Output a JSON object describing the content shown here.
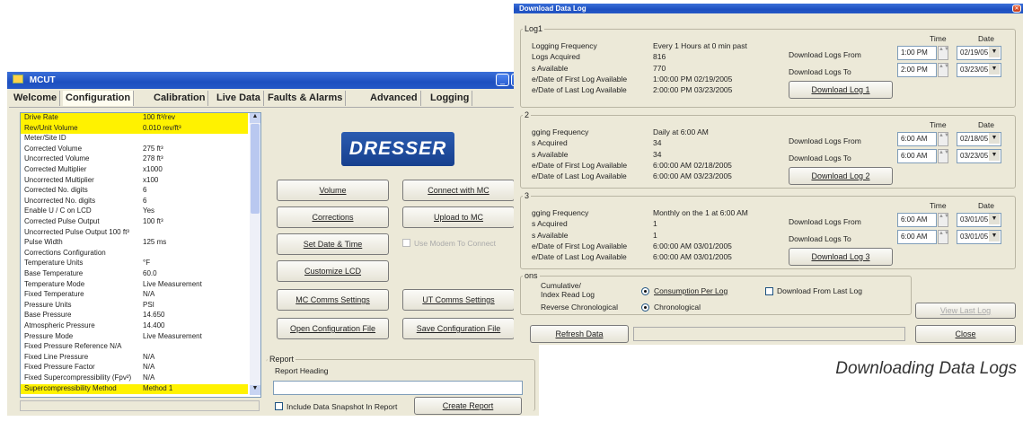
{
  "caption": "Downloading Data Logs",
  "mcut": {
    "title": "MCUT",
    "tabs": [
      "Welcome",
      "Configuration",
      "Calibration",
      "Live Data",
      "Faults & Alarms",
      "Advanced",
      "Logging"
    ],
    "list": [
      {
        "k": "Drive Rate",
        "v": "100 ft³/rev",
        "hl": true
      },
      {
        "k": "Rev/Unit Volume",
        "v": "0.010 rev/ft³",
        "hl": true
      },
      {
        "k": "Meter/Site ID",
        "v": ""
      },
      {
        "k": "Corrected Volume",
        "v": "275 ft³"
      },
      {
        "k": "Uncorrected Volume",
        "v": "278 ft³"
      },
      {
        "k": "Corrected Multiplier",
        "v": "x1000"
      },
      {
        "k": "Uncorrected Multiplier",
        "v": "x100"
      },
      {
        "k": "Corrected No. digits",
        "v": "6"
      },
      {
        "k": "Uncorrected No. digits",
        "v": "6"
      },
      {
        "k": "Enable U / C on LCD",
        "v": "Yes"
      },
      {
        "k": "Corrected Pulse Output",
        "v": "100 ft³"
      },
      {
        "k": "Uncorrected Pulse Output  100 ft³",
        "v": ""
      },
      {
        "k": "Pulse Width",
        "v": "125 ms"
      },
      {
        "k": "Corrections Configuration",
        "v": ""
      },
      {
        "k": "Temperature Units",
        "v": "°F"
      },
      {
        "k": "Base Temperature",
        "v": "60.0"
      },
      {
        "k": "Temperature Mode",
        "v": "Live Measurement"
      },
      {
        "k": "Fixed Temperature",
        "v": "N/A"
      },
      {
        "k": "Pressure Units",
        "v": "PSI"
      },
      {
        "k": "Base Pressure",
        "v": "14.650"
      },
      {
        "k": "Atmospheric Pressure",
        "v": "14.400"
      },
      {
        "k": "Pressure Mode",
        "v": "Live Measurement"
      },
      {
        "k": "Fixed Pressure Reference  N/A",
        "v": ""
      },
      {
        "k": "Fixed Line Pressure",
        "v": "N/A"
      },
      {
        "k": "Fixed Pressure Factor",
        "v": "N/A"
      },
      {
        "k": "Fixed Supercompressibility (Fpv²)",
        "v": "N/A"
      },
      {
        "k": "Supercompressibility Method",
        "v": "Method 1",
        "hl": true
      }
    ],
    "logo": "DRESSER",
    "buttons": {
      "volume": "Volume",
      "connect": "Connect with MC",
      "corrections": "Corrections",
      "upload": "Upload to MC",
      "setdate": "Set Date & Time",
      "modem": "Use Modem To Connect",
      "customize": "Customize LCD",
      "mccomms": "MC Comms Settings",
      "utcomms": "UT Comms Settings",
      "openconf": "Open Configuration File",
      "saveconf": "Save Configuration File"
    },
    "report": {
      "group": "Report",
      "heading": "Report Heading",
      "snapshot": "Include Data Snapshot In Report",
      "create": "Create Report"
    }
  },
  "ddl": {
    "title": "Download Data Log",
    "time_hdr": "Time",
    "date_hdr": "Date",
    "groups": [
      {
        "label": "Log1",
        "rows": [
          [
            "Logging Frequency",
            "Every 1 Hours at 0 min past"
          ],
          [
            "Logs Acquired",
            "816"
          ],
          [
            "s Available",
            "770"
          ],
          [
            "e/Date of First Log Available",
            "1:00:00 PM 02/19/2005"
          ],
          [
            "e/Date of Last Log Available",
            "2:00:00 PM 03/23/2005"
          ]
        ],
        "from_lbl": "Download Logs From",
        "to_lbl": "Download Logs To",
        "from_time": "1:00 PM",
        "from_date": "02/19/05",
        "to_time": "2:00 PM",
        "to_date": "03/23/05",
        "btn": "Download Log 1"
      },
      {
        "label": "2",
        "rows": [
          [
            "gging Frequency",
            "Daily at 6:00 AM"
          ],
          [
            "s Acquired",
            "34"
          ],
          [
            "s Available",
            "34"
          ],
          [
            "e/Date of First Log Available",
            "6:00:00 AM 02/18/2005"
          ],
          [
            "e/Date of Last Log Available",
            "6:00:00 AM 03/23/2005"
          ]
        ],
        "from_lbl": "Download Logs From",
        "to_lbl": "Download Logs To",
        "from_time": "6:00 AM",
        "from_date": "02/18/05",
        "to_time": "6:00 AM",
        "to_date": "03/23/05",
        "btn": "Download Log 2"
      },
      {
        "label": "3",
        "rows": [
          [
            "gging Frequency",
            "Monthly on the 1 at 6:00 AM"
          ],
          [
            "s Acquired",
            "1"
          ],
          [
            "s Available",
            "1"
          ],
          [
            "e/Date of First Log Available",
            "6:00:00 AM 03/01/2005"
          ],
          [
            "e/Date of Last Log Available",
            "6:00:00 AM 03/01/2005"
          ]
        ],
        "from_lbl": "Download Logs From",
        "to_lbl": "Download Logs To",
        "from_time": "6:00 AM",
        "from_date": "03/01/05",
        "to_time": "6:00 AM",
        "to_date": "03/01/05",
        "btn": "Download Log 3"
      }
    ],
    "options": {
      "label": "ons",
      "opt1": "Cumulative/\nIndex Read Log",
      "opt1b": "Consumption Per Log",
      "opt2": "Reverse Chronological",
      "opt2b": "Chronological",
      "last": "Download From Last Log",
      "view": "View Last Log"
    },
    "refresh": "Refresh Data",
    "close": "Close"
  }
}
